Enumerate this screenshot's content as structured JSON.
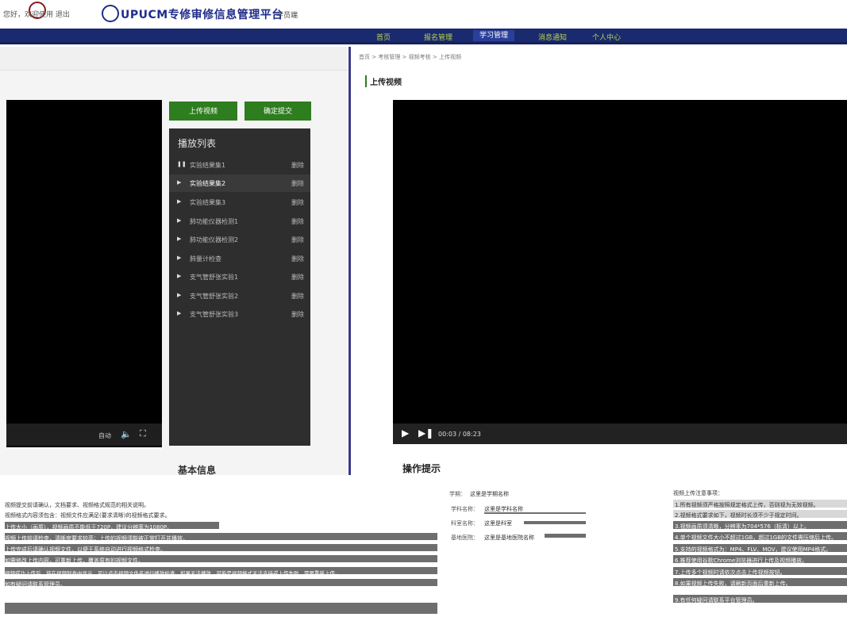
{
  "header": {
    "welcome": "您好，欢迎使用   退出",
    "brand": "UPUCM专修审修信息管理平台",
    "role": "学员端"
  },
  "nav": {
    "items": [
      {
        "label": "首页",
        "active": false
      },
      {
        "label": "报名管理",
        "active": false
      },
      {
        "label": "学习管理",
        "active": true
      },
      {
        "label": "消息通知",
        "active": false
      },
      {
        "label": "个人中心",
        "active": false
      }
    ]
  },
  "breadcrumb": "首页 > 考核管理 > 视频考核 > 上传视频",
  "section_title": "上传视频",
  "buttons": {
    "upload": "上传视频",
    "submit": "确定提交"
  },
  "playlist": {
    "title": "播放列表",
    "delete_label": "删除",
    "items": [
      {
        "name": "实验结果集1",
        "icon": "pause-icon",
        "active": false
      },
      {
        "name": "实验结果集2",
        "icon": "play-icon",
        "active": true
      },
      {
        "name": "实验结果集3",
        "icon": "play-icon",
        "active": false
      },
      {
        "name": "肺功能仪器检测1",
        "icon": "play-icon",
        "active": false
      },
      {
        "name": "肺功能仪器检测2",
        "icon": "play-icon",
        "active": false
      },
      {
        "name": "肺量计检查",
        "icon": "play-icon",
        "active": false
      },
      {
        "name": "支气管舒张实验1",
        "icon": "play-icon",
        "active": false
      },
      {
        "name": "支气管舒张实验2",
        "icon": "play-icon",
        "active": false
      },
      {
        "name": "支气管舒张实验3",
        "icon": "play-icon",
        "active": false
      }
    ]
  },
  "left_player": {
    "auto_label": "自动"
  },
  "right_player": {
    "time": "00:03 / 08:23"
  },
  "basic_info": {
    "title": "基本信息",
    "fields": [
      {
        "label": "学期：",
        "value": "这里是学期名称"
      },
      {
        "label": "学科名称：",
        "value": "这里是学科名称"
      },
      {
        "label": "科室名称：",
        "value": "这里是科室"
      },
      {
        "label": "基地医院：",
        "value": "这里是基地医院名称"
      }
    ]
  },
  "tips": {
    "title": "操作提示",
    "lines": [
      "视频提交前请确认，文档要求、视频格式规范的相关说明。",
      "视频格式内容须包含：视频文件应满足(要求清晰)的视频格式要求。",
      "上传大小（画质），视频画质不能低于720P，建议分辨率为1080P。",
      "视频上传前请检查，清晰度要求较高；上传的视频须能被正常打开并播放。",
      "上传完成后请确认视频文件，以便于系统自动进行视频格式检查。",
      "如需修改上传内容，可重新上传，覆盖原有的视频文件。",
      "视频成功上传后，将在视频列表中显示，可以点击视频文件名进行播放检查，如果无法播放，可能是视频格式无法支持或上传失败，需要重新上传。",
      "如有疑问请联系管理员。"
    ]
  },
  "notes": {
    "title": "视频上传注意事项：",
    "lines": [
      "1.所有视频须严格按照规定格式上传，否则视为无效视频。",
      "2.视频格式要求如下，视频时长须不少于规定时间。",
      "3.视频画质须清晰，分辨率为704*576（标清）以上。",
      "4.单个视频文件大小不超过1GB，超过1GB的文件需压缩后上传。",
      "5.支持的视频格式为：MP4、FLV、MOV，建议使用MP4格式。",
      "6.推荐使用谷歌Chrome浏览器进行上传及视频播放。",
      "7.上传多个视频时请依次点击上传视频按钮。",
      "8.如果视频上传失败，请刷新页面后重新上传。",
      "9.有任何疑问请联系平台管理员。"
    ]
  }
}
